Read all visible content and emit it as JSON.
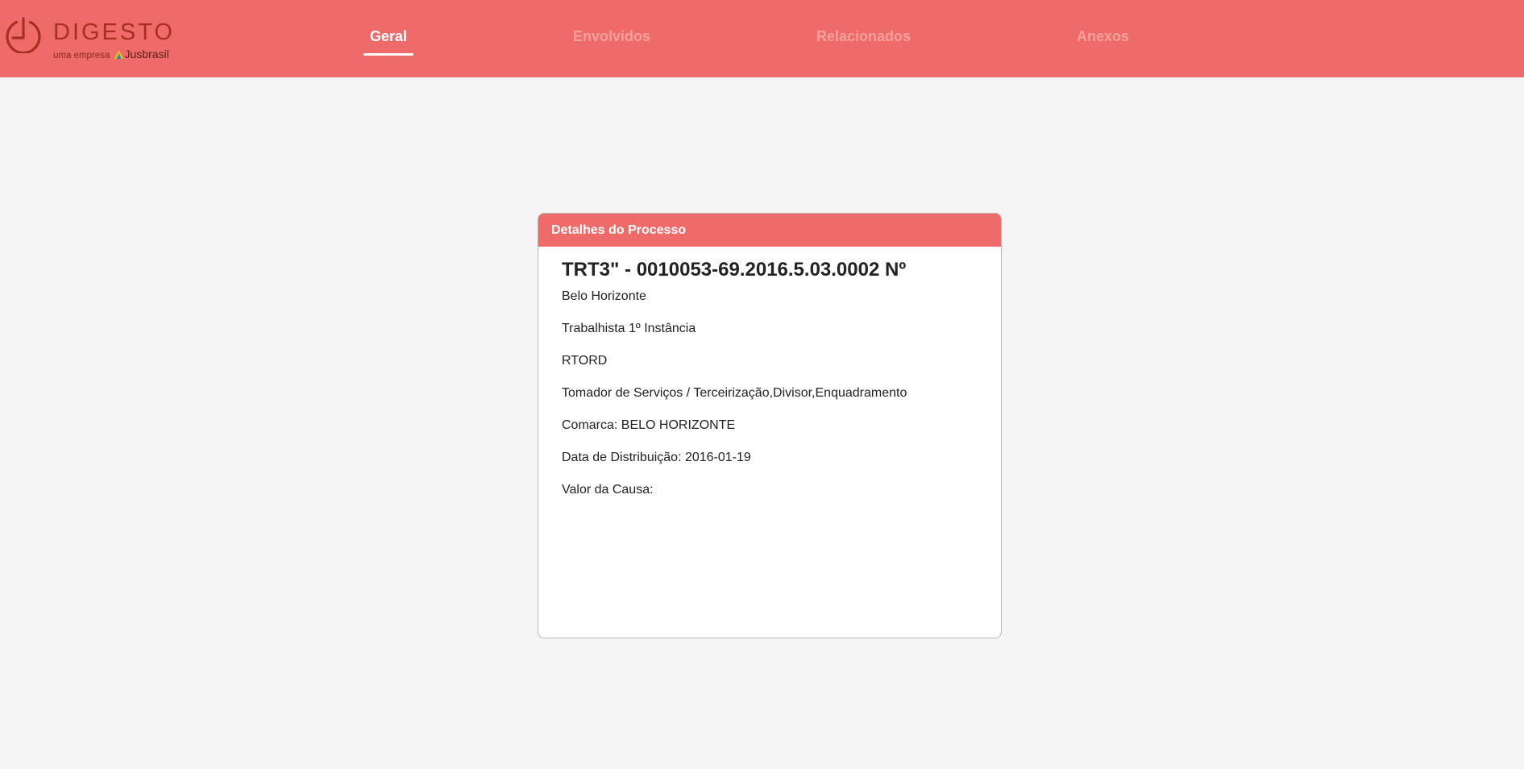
{
  "brand": {
    "name": "DIGESTO",
    "tagline_prefix": "uma empresa",
    "tagline_partner": "Jusbrasil",
    "color": "#a5301f"
  },
  "nav": {
    "tabs": [
      {
        "label": "Geral",
        "active": true
      },
      {
        "label": "Envolvidos",
        "active": false
      },
      {
        "label": "Relacionados",
        "active": false
      },
      {
        "label": "Anexos",
        "active": false
      }
    ],
    "accent": "#ee6b69"
  },
  "card": {
    "header": "Detalhes do Processo",
    "title": "TRT3\" - 0010053-69.2016.5.03.0002 Nº",
    "details": [
      "Belo Horizonte",
      "Trabalhista 1º Instância",
      "RTORD",
      "Tomador de Serviços / Terceirização,Divisor,Enquadramento",
      "Comarca: BELO HORIZONTE",
      "Data de Distribuição: 2016-01-19",
      "Valor da Causa:"
    ]
  }
}
